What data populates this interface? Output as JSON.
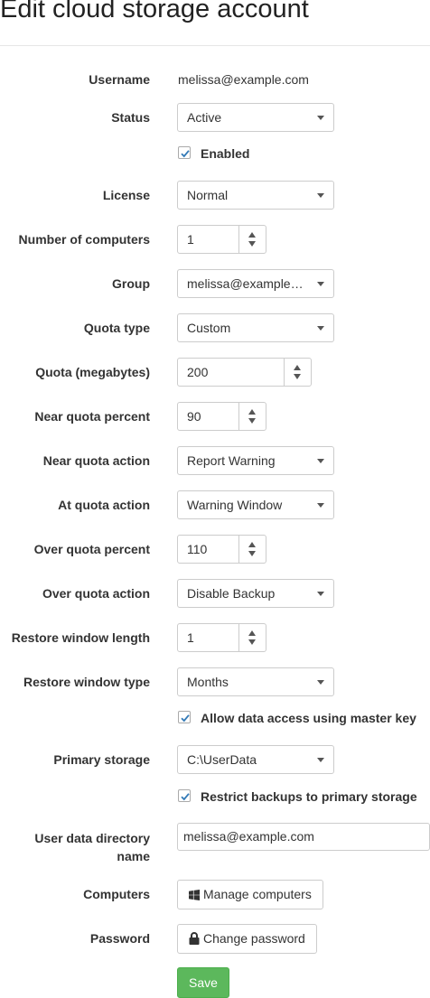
{
  "page": {
    "title": "Edit cloud storage account"
  },
  "form": {
    "username": {
      "label": "Username",
      "value": "melissa@example.com"
    },
    "status": {
      "label": "Status",
      "value": "Active"
    },
    "enabled": {
      "label": "Enabled",
      "checked": true
    },
    "license": {
      "label": "License",
      "value": "Normal"
    },
    "num_computers": {
      "label": "Number of computers",
      "value": "1"
    },
    "group": {
      "label": "Group",
      "value": "melissa@example.com"
    },
    "quota_type": {
      "label": "Quota type",
      "value": "Custom"
    },
    "quota_mb": {
      "label": "Quota (megabytes)",
      "value": "200"
    },
    "near_quota_percent": {
      "label": "Near quota percent",
      "value": "90"
    },
    "near_quota_action": {
      "label": "Near quota action",
      "value": "Report Warning"
    },
    "at_quota_action": {
      "label": "At quota action",
      "value": "Warning Window"
    },
    "over_quota_percent": {
      "label": "Over quota percent",
      "value": "110"
    },
    "over_quota_action": {
      "label": "Over quota action",
      "value": "Disable Backup"
    },
    "restore_window_length": {
      "label": "Restore window length",
      "value": "1"
    },
    "restore_window_type": {
      "label": "Restore window type",
      "value": "Months"
    },
    "allow_master_key": {
      "label": "Allow data access using master key",
      "checked": true
    },
    "primary_storage": {
      "label": "Primary storage",
      "value": "C:\\UserData"
    },
    "restrict_primary": {
      "label": "Restrict backups to primary storage",
      "checked": true
    },
    "user_data_dir": {
      "label_line1": "User data directory",
      "label_line2": "name",
      "value": "melissa@example.com"
    },
    "computers": {
      "label": "Computers",
      "button": "Manage computers",
      "icon": "windows-icon"
    },
    "password": {
      "label": "Password",
      "button": "Change password",
      "icon": "lock-icon"
    },
    "save": {
      "label": "Save"
    }
  },
  "colors": {
    "save_button": "#5cb85c",
    "checkbox_check": "#337ab7"
  }
}
